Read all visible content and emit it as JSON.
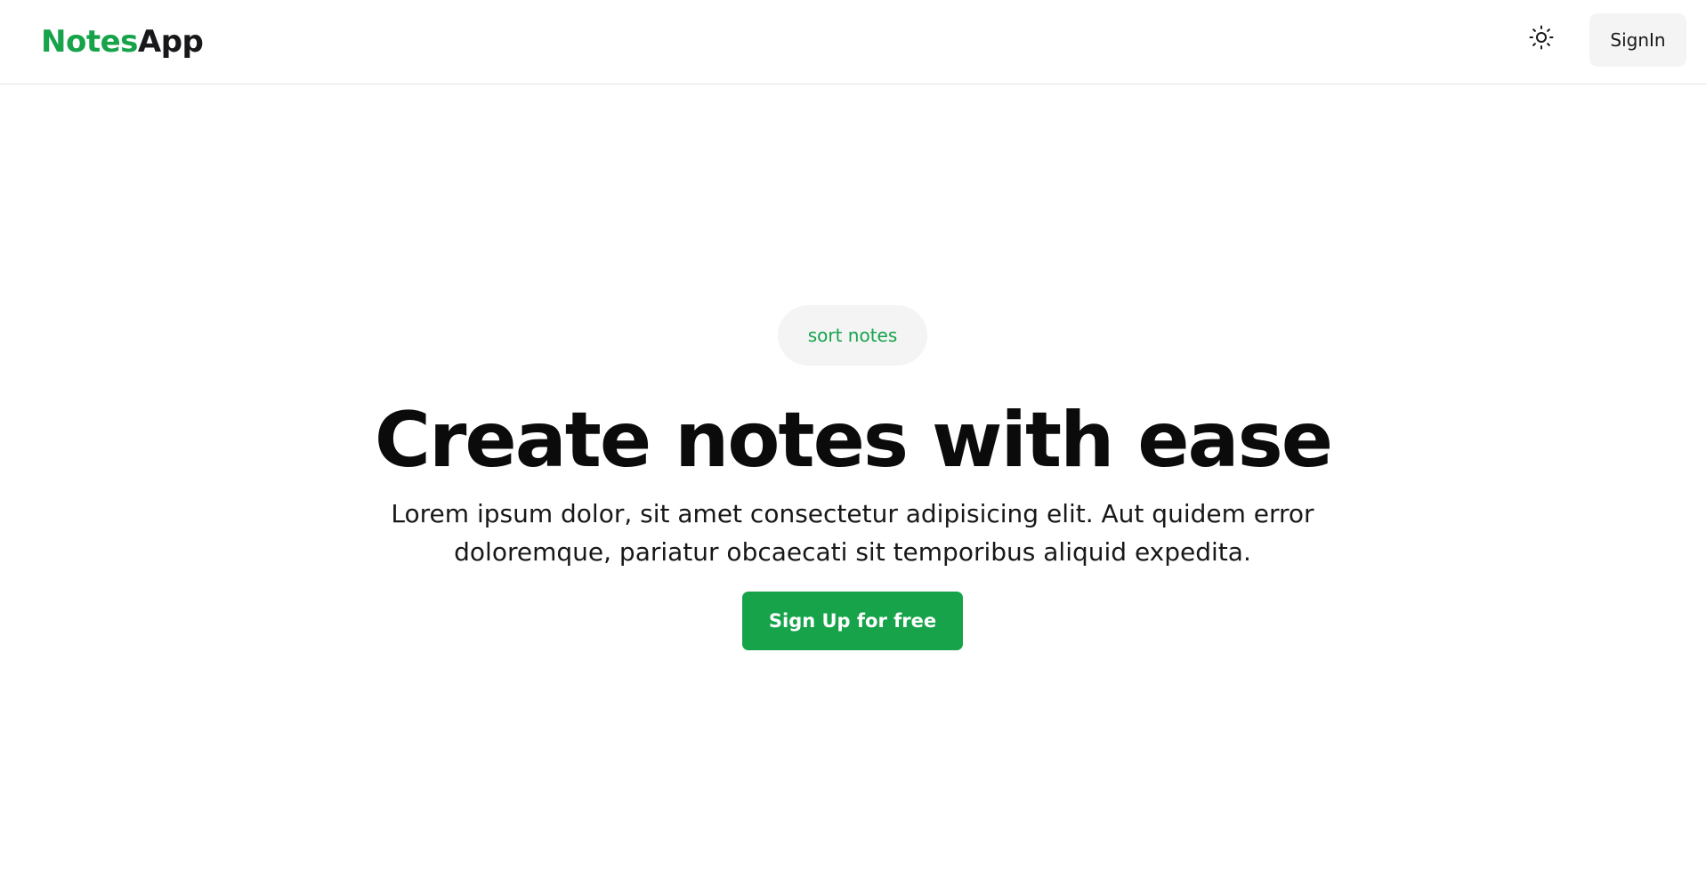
{
  "header": {
    "logo_primary": "Notes",
    "logo_secondary": "App",
    "theme_icon": "sun-icon",
    "signin_label": "SignIn"
  },
  "hero": {
    "badge_label": "sort notes",
    "headline": "Create notes with ease",
    "description": "Lorem ipsum dolor, sit amet consectetur adipisicing elit. Aut quidem error doloremque, pariatur obcaecati sit temporibus aliquid expedita.",
    "cta_label": "Sign Up for free"
  },
  "colors": {
    "accent": "#16a34a",
    "text": "#0b0b0c",
    "muted_bg": "#f4f4f5",
    "border": "#e4e4e7"
  }
}
